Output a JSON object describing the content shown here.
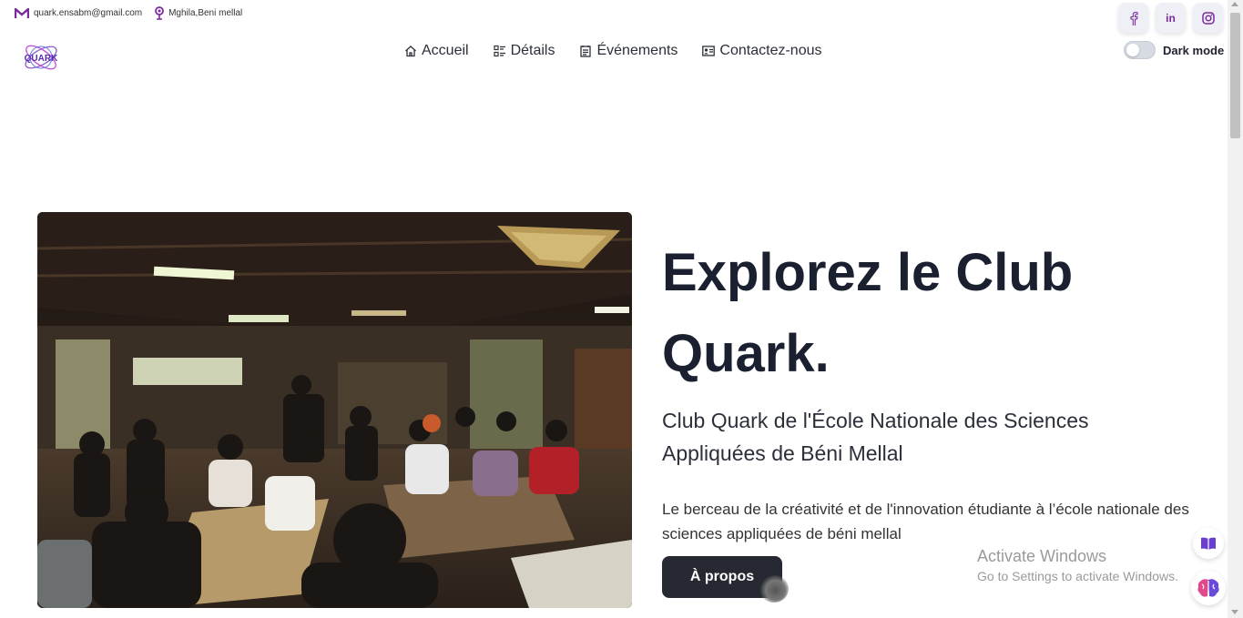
{
  "topbar": {
    "email": "quark.ensabm@gmail.com",
    "location": "Mghila,Beni mellal"
  },
  "logo": {
    "text": "QUARK"
  },
  "nav": {
    "items": [
      {
        "label": "Accueil",
        "icon": "home-icon"
      },
      {
        "label": "Détails",
        "icon": "list-icon"
      },
      {
        "label": "Événements",
        "icon": "calendar-icon"
      },
      {
        "label": "Contactez-nous",
        "icon": "contact-card-icon"
      }
    ]
  },
  "social": {
    "facebook": "f",
    "linkedin": "in",
    "instagram": "instagram-icon"
  },
  "darkmode": {
    "label": "Dark mode",
    "enabled": false
  },
  "hero": {
    "title_line1": "Explorez le Club",
    "title_line2": "Quark.",
    "subtitle": "Club Quark de l'École Nationale des Sciences Appliquées de Béni Mellal",
    "description": "Le berceau de la créativité et de l'innovation étudiante à l’école nationale des sciences appliquées de béni mellal",
    "button_label": "À propos"
  },
  "watermark": {
    "line1": "Activate Windows",
    "line2": "Go to Settings to activate Windows."
  },
  "colors": {
    "accent": "#7b2a9e",
    "button_bg": "#262832",
    "title": "#1b2030"
  }
}
